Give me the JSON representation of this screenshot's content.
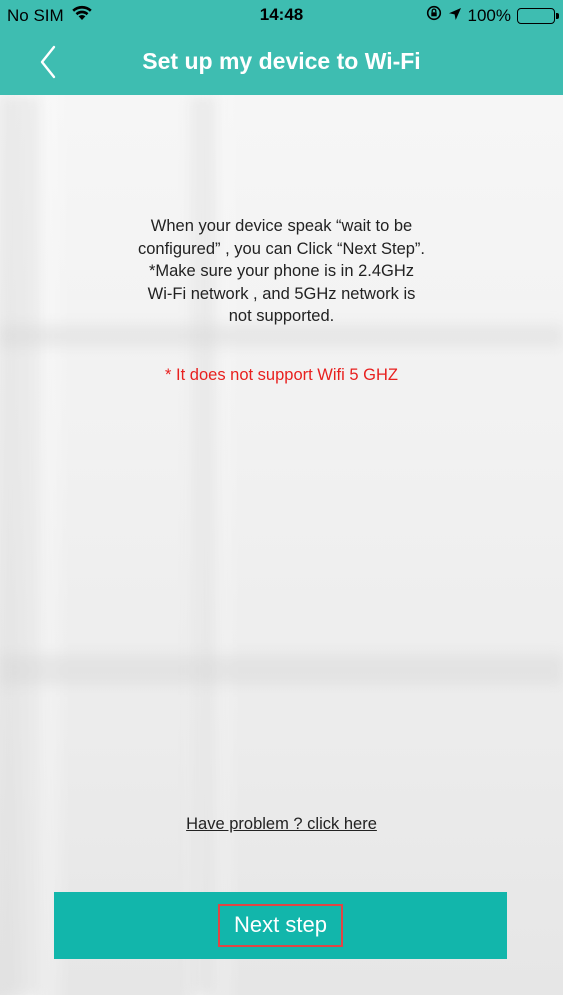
{
  "status_bar": {
    "carrier": "No SIM",
    "time": "14:48",
    "battery": "100%",
    "icons": [
      "wifi-icon",
      "rotation-lock-icon",
      "location-arrow-icon",
      "battery-icon"
    ]
  },
  "nav": {
    "back_icon": "chevron-left-icon",
    "title": "Set up my device to Wi-Fi"
  },
  "instructions": {
    "lines": [
      "When your device speak “wait to be",
      "configured” , you can Click “Next Step”.",
      "*Make sure your phone is in 2.4GHz",
      "Wi-Fi network , and 5GHz network is",
      "not supported."
    ]
  },
  "warning": "* It does not support Wifi 5 GHZ",
  "problem_link": "Have problem ? click here",
  "next_button": {
    "label": "Next step"
  },
  "colors": {
    "header": "#3ebdb1",
    "button": "#12b6ab",
    "warning": "#e8201f",
    "highlight": "#e24545"
  }
}
